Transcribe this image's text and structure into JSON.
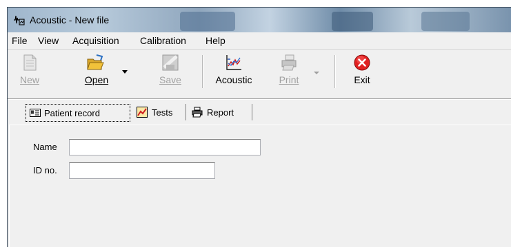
{
  "window": {
    "title": "Acoustic - New file",
    "icon": "app-waveform-icon"
  },
  "menu": [
    "File",
    "View",
    "Acquisition",
    "Calibration",
    "Help"
  ],
  "toolbar": {
    "new": {
      "label": "New",
      "icon": "new-file-icon",
      "enabled": false
    },
    "open": {
      "label": "Open",
      "icon": "open-folder-icon",
      "enabled": true
    },
    "save": {
      "label": "Save",
      "icon": "save-disk-icon",
      "enabled": false
    },
    "acoustic": {
      "label": "Acoustic",
      "icon": "acoustic-chart-icon",
      "enabled": true
    },
    "print": {
      "label": "Print",
      "icon": "printer-icon",
      "enabled": false
    },
    "exit": {
      "label": "Exit",
      "icon": "exit-x-icon",
      "enabled": true
    }
  },
  "tabs": [
    {
      "label": "Patient record",
      "icon": "id-card-icon",
      "active": true
    },
    {
      "label": "Tests",
      "icon": "chart-tests-icon",
      "active": false
    },
    {
      "label": "Report",
      "icon": "printer-icon",
      "active": false
    }
  ],
  "patient": {
    "name_label": "Name",
    "name_value": "",
    "id_label": "ID no.",
    "id_value": ""
  },
  "colors": {
    "exit_red": "#e02020",
    "open_yellow": "#f2c23a",
    "tab_red": "#d02020"
  }
}
